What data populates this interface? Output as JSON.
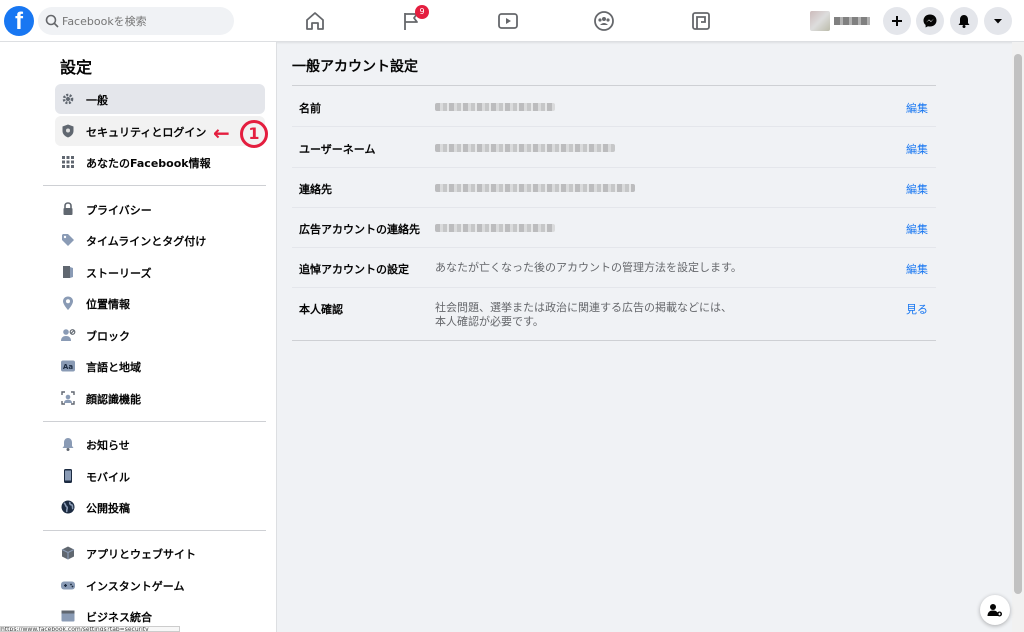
{
  "topbar": {
    "logo": "f",
    "search_placeholder": "Facebookを検索",
    "notification_count": "9",
    "icons": [
      "home-icon",
      "flag-icon",
      "watch-icon",
      "groups-icon",
      "gaming-icon",
      "plus-icon",
      "messenger-icon",
      "bell-icon",
      "caret-down-icon"
    ]
  },
  "sidebar": {
    "title": "設定",
    "items": [
      {
        "label": "一般"
      },
      {
        "label": "セキュリティとログイン"
      },
      {
        "label": "あなたのFacebook情報"
      },
      {
        "label": "プライバシー"
      },
      {
        "label": "タイムラインとタグ付け"
      },
      {
        "label": "ストーリーズ"
      },
      {
        "label": "位置情報"
      },
      {
        "label": "ブロック"
      },
      {
        "label": "言語と地域"
      },
      {
        "label": "顔認識機能"
      },
      {
        "label": "お知らせ"
      },
      {
        "label": "モバイル"
      },
      {
        "label": "公開投稿"
      },
      {
        "label": "アプリとウェブサイト"
      },
      {
        "label": "インスタントゲーム"
      },
      {
        "label": "ビジネス統合"
      }
    ],
    "annotation_number": "①",
    "annotation_arrow": "←"
  },
  "main": {
    "title": "一般アカウント設定",
    "rows": [
      {
        "key": "名前",
        "action": "編集"
      },
      {
        "key": "ユーザーネーム",
        "action": "編集"
      },
      {
        "key": "連絡先",
        "action": "編集"
      },
      {
        "key": "広告アカウントの連絡先",
        "action": "編集"
      },
      {
        "key": "追悼アカウントの設定",
        "value": "あなたが亡くなった後のアカウントの管理方法を設定します。",
        "action": "編集"
      },
      {
        "key": "本人確認",
        "value": "社会問題、選挙または政治に関連する広告の掲載などには、本人確認が必要です。",
        "action": "見る"
      }
    ]
  },
  "status_bar": {
    "url": "https://www.facebook.com/settings?tab=security"
  },
  "colors": {
    "brand": "#1877f2",
    "annotation": "#e41e3f"
  }
}
